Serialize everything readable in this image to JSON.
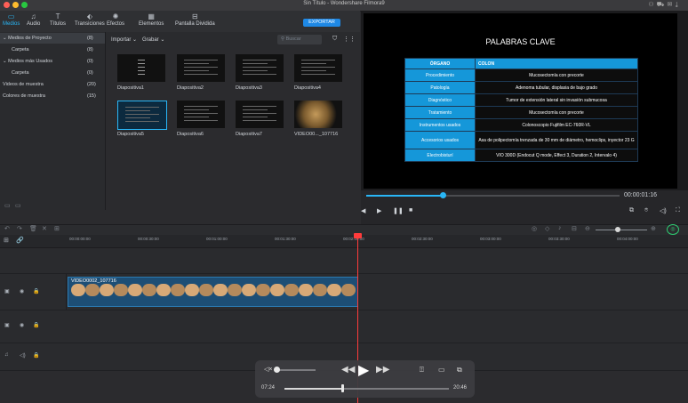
{
  "window": {
    "title": "Sin Título - Wondershare Filmora9"
  },
  "tabs": [
    {
      "label": "Medios",
      "icon": "folder-icon",
      "active": true
    },
    {
      "label": "Audio",
      "icon": "music-icon",
      "active": false
    },
    {
      "label": "Títulos",
      "icon": "text-icon",
      "active": false
    },
    {
      "label": "Transiciones",
      "icon": "transition-icon",
      "active": false
    },
    {
      "label": "Efectos",
      "icon": "effects-icon",
      "active": false
    },
    {
      "label": "Elementos",
      "icon": "elements-icon",
      "active": false
    },
    {
      "label": "Pantalla Dividida",
      "icon": "split-screen-icon",
      "active": false
    }
  ],
  "export_label": "EXPORTAR",
  "left_pane": [
    {
      "label": "Medios de Proyecto",
      "count": "(8)",
      "selected": true,
      "indent": false,
      "caret": true
    },
    {
      "label": "Carpeta",
      "count": "(8)",
      "selected": false,
      "indent": true
    },
    {
      "label": "Medios más Usados",
      "count": "(0)",
      "selected": false,
      "indent": false,
      "caret": true
    },
    {
      "label": "Carpeta",
      "count": "(0)",
      "selected": false,
      "indent": true
    },
    {
      "label": "Videos de muestra",
      "count": "(20)",
      "selected": false,
      "indent": false
    },
    {
      "label": "Colores de muestra",
      "count": "(15)",
      "selected": false,
      "indent": false
    }
  ],
  "media_bar": {
    "import": "Importar",
    "record": "Grabar",
    "search_placeholder": "Buscar"
  },
  "media_items": [
    {
      "label": "Diapositiva1"
    },
    {
      "label": "Diapositiva2"
    },
    {
      "label": "Diapositiva3"
    },
    {
      "label": "Diapositiva4"
    },
    {
      "label": "Diapositiva5"
    },
    {
      "label": "Diapositiva6"
    },
    {
      "label": "Diapositiva7"
    },
    {
      "label": "VIDEO00..._107716"
    }
  ],
  "slide": {
    "title": "PALABRAS CLAVE",
    "header": [
      "ÓRGANO",
      "COLON"
    ],
    "rows": [
      [
        "Procedimiento",
        "Mucosectomía con precorte"
      ],
      [
        "Patología",
        "Adenoma tubular, displasia de bajo grado"
      ],
      [
        "Diagnóstico",
        "Tumor de extensión lateral sin invasión submucosa"
      ],
      [
        "Tratamiento",
        "Mucosectomía con precorte"
      ],
      [
        "Instrumentos usados",
        "Colonoscopio Fujifilm EC-760R-VL"
      ],
      [
        "Accesorios usados",
        "Asa de polipectomía trenzada de 30 mm de diámetro, hemoclips, inyector 23 G"
      ],
      [
        "Electrobisturí",
        "VIO 300D (Endocut Q mode, Effect 3, Duration 2, Intervalo 4)"
      ]
    ]
  },
  "playback": {
    "timecode": "00:00:01:16",
    "progress": 0.3
  },
  "ruler_ticks": [
    "00:00:00:00",
    "00:00:30:00",
    "00:01:00:00",
    "00:01:30:00",
    "00:02:00:00",
    "00:02:30:00",
    "00:03:00:00",
    "00:03:30:00",
    "00:04:00:00"
  ],
  "clip": {
    "label": "VIDEO0002_107716"
  },
  "overlay_player": {
    "elapsed": "07:24",
    "remaining": "20:46",
    "progress": 0.35
  }
}
